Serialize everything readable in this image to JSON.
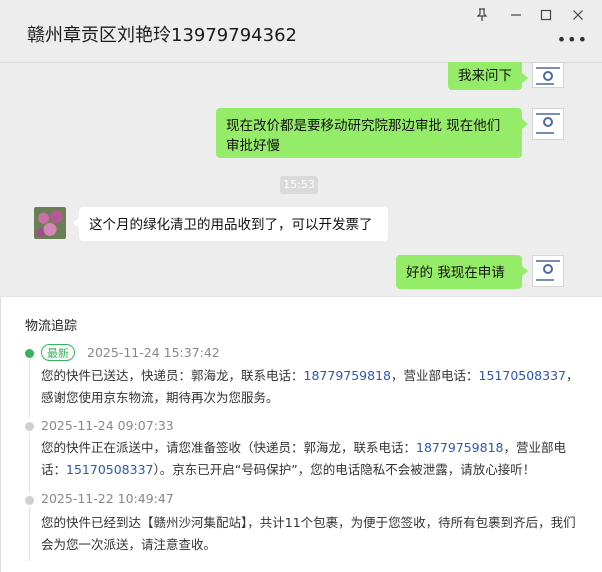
{
  "window": {
    "title": "赣州章贡区刘艳玲13979794362",
    "pin_icon": "pin-icon",
    "minimize_icon": "minimize-icon",
    "maximize_icon": "maximize-icon",
    "close_icon": "close-icon",
    "more_icon": "more-icon"
  },
  "chat": {
    "messages": [
      {
        "sender": "me",
        "text": "我来问下"
      },
      {
        "sender": "me",
        "text": "现在改价都是要移动研究院那边审批  现在他们审批好慢"
      },
      {
        "sender": "other",
        "text": "这个月的绿化清卫的用品收到了，可以开发票了"
      },
      {
        "sender": "me",
        "text": "好的  我现在申请"
      }
    ],
    "timestamp": "15:53"
  },
  "tracking": {
    "title": "物流追踪",
    "badge": "最新",
    "entries": [
      {
        "time": "2025-11-24 15:37:42",
        "p1": "您的快件已送达，快递员：郭海龙，联系电话：",
        "phone1": "18779759818",
        "p2": "，营业部电话：",
        "phone2": "15170508337",
        "p3": "，感谢您使用京东物流，期待再次为您服务。"
      },
      {
        "time": "2025-11-24 09:07:33",
        "p1": "您的快件正在派送中，请您准备签收（快递员：郭海龙，联系电话：",
        "phone1": "18779759818",
        "p2": "，营业部电话：",
        "phone2": "15170508337",
        "p3": "）。京东已开启“号码保护”，您的电话隐私不会被泄露，请放心接听！"
      },
      {
        "time": "2025-11-22 10:49:47",
        "text": "您的快件已经到达【赣州沙河集配站】，共计11个包裹，为便于您签收，待所有包裹到齐后，我们会为您一次派送，请注意查收。"
      }
    ]
  },
  "colors": {
    "bubble_me": "#95ec69",
    "accent_green": "#35b35a",
    "phone_link": "#2d57b8"
  }
}
